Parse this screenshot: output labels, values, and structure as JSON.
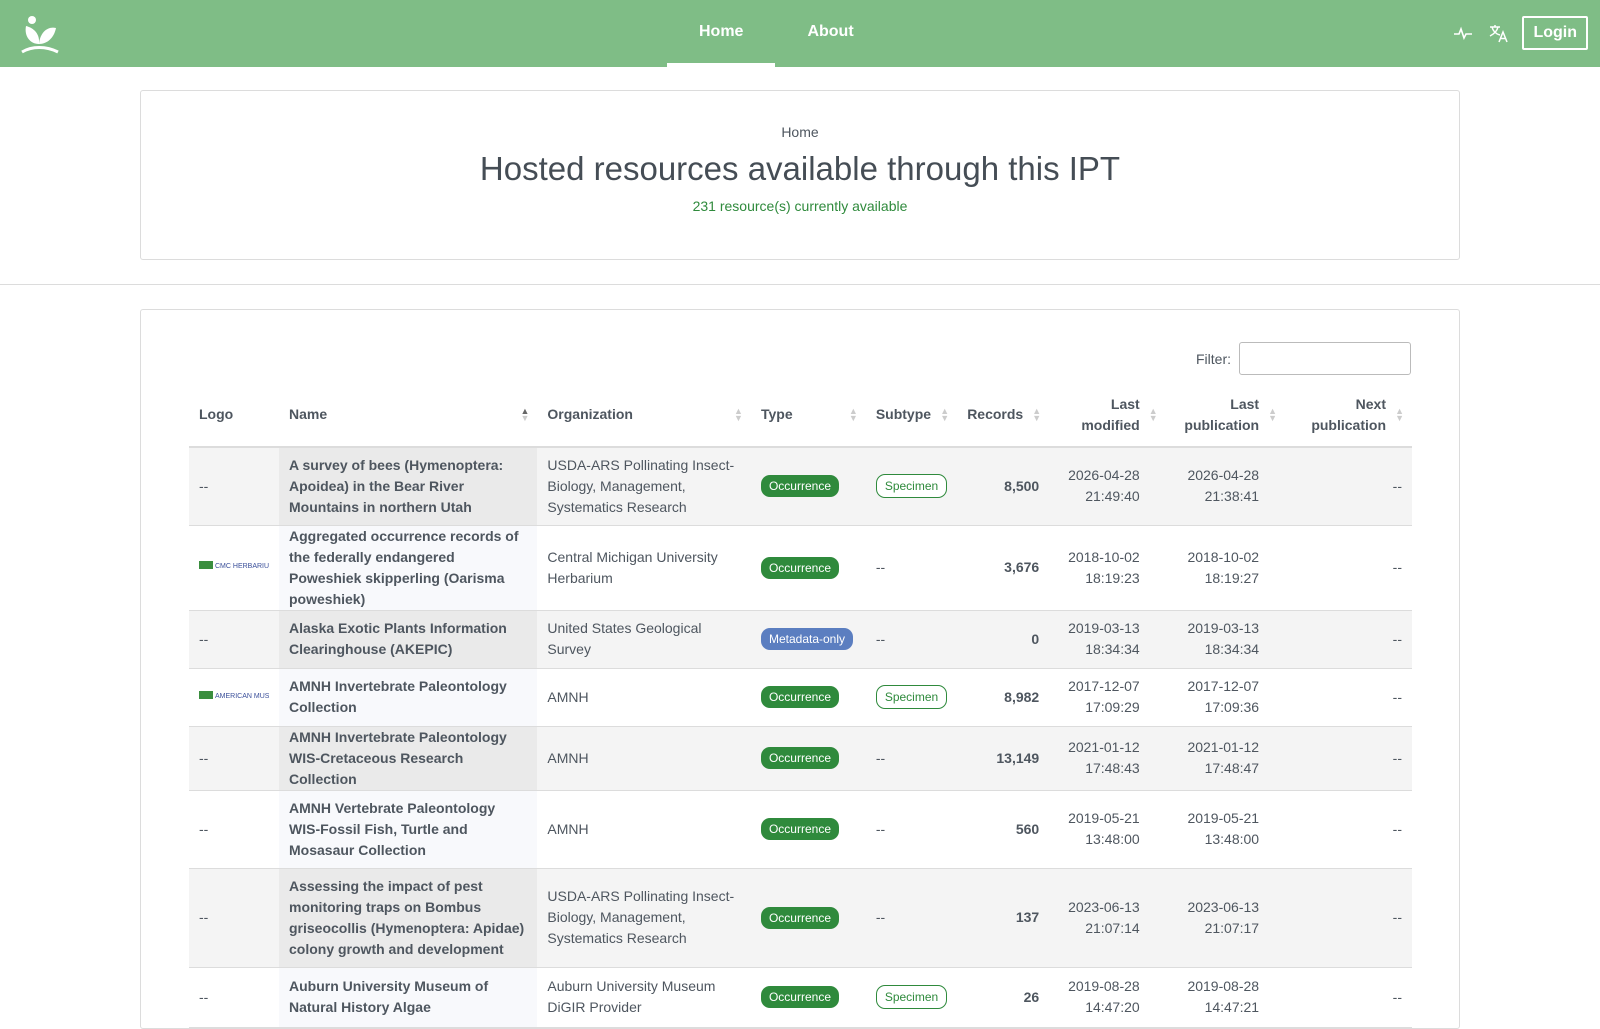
{
  "nav": {
    "links": [
      {
        "label": "Home",
        "active": true
      },
      {
        "label": "About",
        "active": false
      }
    ],
    "login_label": "Login",
    "icons": [
      "gbif-logo-icon",
      "health-pulse-icon",
      "translate-icon"
    ]
  },
  "header": {
    "breadcrumb": "Home",
    "title": "Hosted resources available through this IPT",
    "subtitle": "231 resource(s) currently available"
  },
  "filter": {
    "label": "Filter:",
    "value": ""
  },
  "table": {
    "columns": [
      "Logo",
      "Name",
      "Organization",
      "Type",
      "Subtype",
      "Records",
      "Last modified",
      "Last publication",
      "Next publication"
    ],
    "rows": [
      {
        "logo": "--",
        "name": "A survey of bees (Hymenoptera: Apoidea) in the Bear River Mountains in northern Utah",
        "org": "USDA-ARS Pollinating Insect-Biology, Management, Systematics Research",
        "type": "Occurrence",
        "subtype": "Specimen",
        "records": "8,500",
        "modified": [
          "2026-04-28",
          "21:49:40"
        ],
        "published": [
          "2026-04-28",
          "21:38:41"
        ],
        "next": "--"
      },
      {
        "logo": "CMC HERBARIUM",
        "name": "Aggregated occurrence records of the federally endangered Poweshiek skipperling (Oarisma poweshiek)",
        "org": "Central Michigan University Herbarium",
        "type": "Occurrence",
        "subtype": "--",
        "records": "3,676",
        "modified": [
          "2018-10-02",
          "18:19:23"
        ],
        "published": [
          "2018-10-02",
          "18:19:27"
        ],
        "next": "--"
      },
      {
        "logo": "--",
        "name": "Alaska Exotic Plants Information Clearinghouse (AKEPIC)",
        "org": "United States Geological Survey",
        "type": "Metadata-only",
        "subtype": "--",
        "records": "0",
        "modified": [
          "2019-03-13",
          "18:34:34"
        ],
        "published": [
          "2019-03-13",
          "18:34:34"
        ],
        "next": "--"
      },
      {
        "logo": "AMERICAN MUSEUM of NATURAL HISTORY",
        "name": "AMNH Invertebrate Paleontology Collection",
        "org": "AMNH",
        "type": "Occurrence",
        "subtype": "Specimen",
        "records": "8,982",
        "modified": [
          "2017-12-07",
          "17:09:29"
        ],
        "published": [
          "2017-12-07",
          "17:09:36"
        ],
        "next": "--"
      },
      {
        "logo": "--",
        "name": "AMNH Invertebrate Paleontology WIS-Cretaceous Research Collection",
        "org": "AMNH",
        "type": "Occurrence",
        "subtype": "--",
        "records": "13,149",
        "modified": [
          "2021-01-12",
          "17:48:43"
        ],
        "published": [
          "2021-01-12",
          "17:48:47"
        ],
        "next": "--"
      },
      {
        "logo": "--",
        "name": "AMNH Vertebrate Paleontology WIS-Fossil Fish, Turtle and Mosasaur Collection",
        "org": "AMNH",
        "type": "Occurrence",
        "subtype": "--",
        "records": "560",
        "modified": [
          "2019-05-21",
          "13:48:00"
        ],
        "published": [
          "2019-05-21",
          "13:48:00"
        ],
        "next": "--"
      },
      {
        "logo": "--",
        "name": "Assessing the impact of pest monitoring traps on Bombus griseocollis (Hymenoptera: Apidae) colony growth and development",
        "org": "USDA-ARS Pollinating Insect-Biology, Management, Systematics Research",
        "type": "Occurrence",
        "subtype": "--",
        "records": "137",
        "modified": [
          "2023-06-13",
          "21:07:14"
        ],
        "published": [
          "2023-06-13",
          "21:07:17"
        ],
        "next": "--"
      },
      {
        "logo": "--",
        "name": "Auburn University Museum of Natural History Algae",
        "org": "Auburn University Museum DiGIR Provider",
        "type": "Occurrence",
        "subtype": "Specimen",
        "records": "26",
        "modified": [
          "2019-08-28",
          "14:47:20"
        ],
        "published": [
          "2019-08-28",
          "14:47:21"
        ],
        "next": "--"
      }
    ]
  }
}
